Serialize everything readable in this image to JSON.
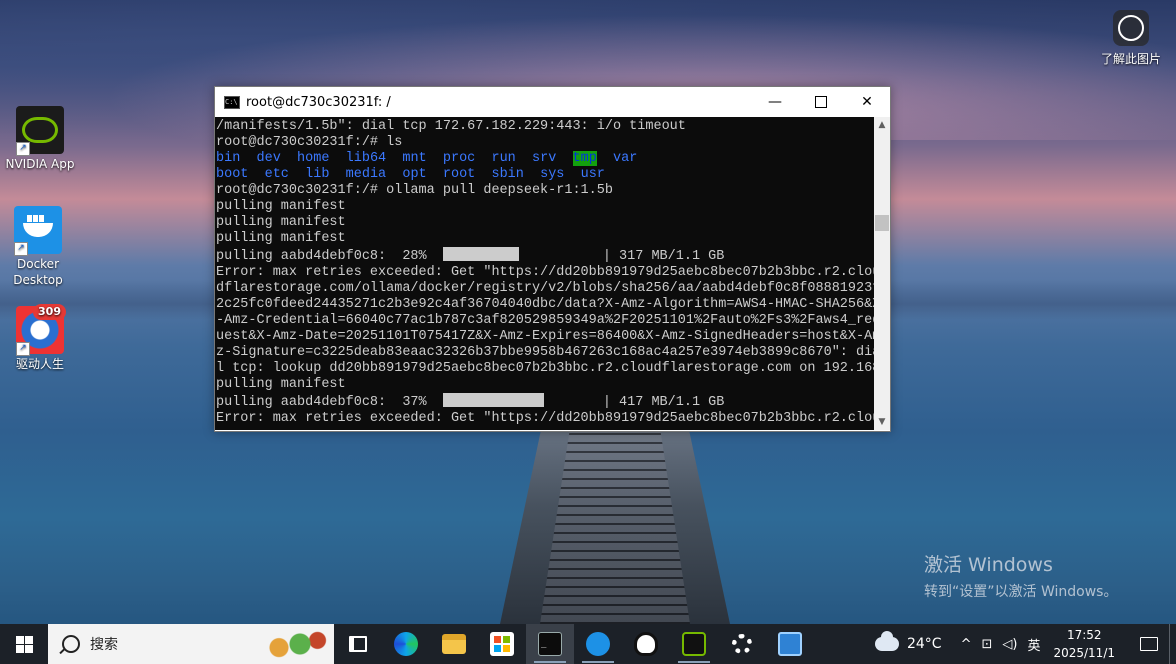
{
  "desktop": {
    "icons": [
      {
        "label": "NVIDIA App"
      },
      {
        "label": "Docker Desktop"
      },
      {
        "label": "驱动人生",
        "badge": "309"
      }
    ],
    "learn_label": "了解此图片",
    "watermark_line1": "激活 Windows",
    "watermark_line2": "转到“设置”以激活 Windows。"
  },
  "window": {
    "title": "root@dc730c30231f: /",
    "minimize_glyph": "—",
    "close_glyph": "✕",
    "scroll_up": "▲",
    "scroll_down": "▼",
    "lines": [
      "/manifests/1.5b\": dial tcp 172.67.182.229:443: i/o timeout",
      "root@dc730c30231f:/# ls",
      "root@dc730c30231f:/# ollama pull deepseek-r1:1.5b",
      "pulling manifest",
      "pulling manifest",
      "pulling manifest",
      "Error: max retries exceeded: Get \"https://dd20bb891979d25aebc8bec07b2b3bbc.r2.clou",
      "dflarestorage.com/ollama/docker/registry/v2/blobs/sha256/aa/aabd4debf0c8f08881923f",
      "2c25fc0fdeed24435271c2b3e92c4af36704040dbc/data?X-Amz-Algorithm=AWS4-HMAC-SHA256&X",
      "-Amz-Credential=66040c77ac1b787c3af820529859349a%2F20251101%2Fauto%2Fs3%2Faws4_req",
      "uest&X-Amz-Date=20251101T075417Z&X-Amz-Expires=86400&X-Amz-SignedHeaders=host&X-Am",
      "z-Signature=c3225deab83eaac32326b37bbe9958b467263c168ac4a257e3974eb3899c8670\": dia",
      "l tcp: lookup dd20bb891979d25aebc8bec07b2b3bbc.r2.cloudflarestorage.com on 192.168",
      "pulling manifest",
      "Error: max retries exceeded: Get \"https://dd20bb891979d25aebc8bec07b2b3bbc.r2.clou"
    ],
    "ls_row1": [
      "bin",
      "dev",
      "home",
      "lib64",
      "mnt",
      "proc",
      "run",
      "srv",
      "tmp",
      "var"
    ],
    "ls_row2": [
      "boot",
      "etc",
      "lib",
      "media",
      "opt",
      "root",
      "sbin",
      "sys",
      "usr"
    ],
    "progress": [
      {
        "prefix": "pulling aabd4debf0c8:  28%",
        "size": "317 MB/1.1 GB",
        "fraction": 0.28
      },
      {
        "prefix": "pulling aabd4debf0c8:  37%",
        "size": "417 MB/1.1 GB",
        "fraction": 0.37
      }
    ]
  },
  "taskbar": {
    "search_placeholder": "搜索",
    "weather": "24°C",
    "ime": "英",
    "time": "17:52",
    "date": "2025/11/1",
    "tray_up": "^",
    "tray_net": "⊡",
    "tray_vol": "◁)"
  }
}
